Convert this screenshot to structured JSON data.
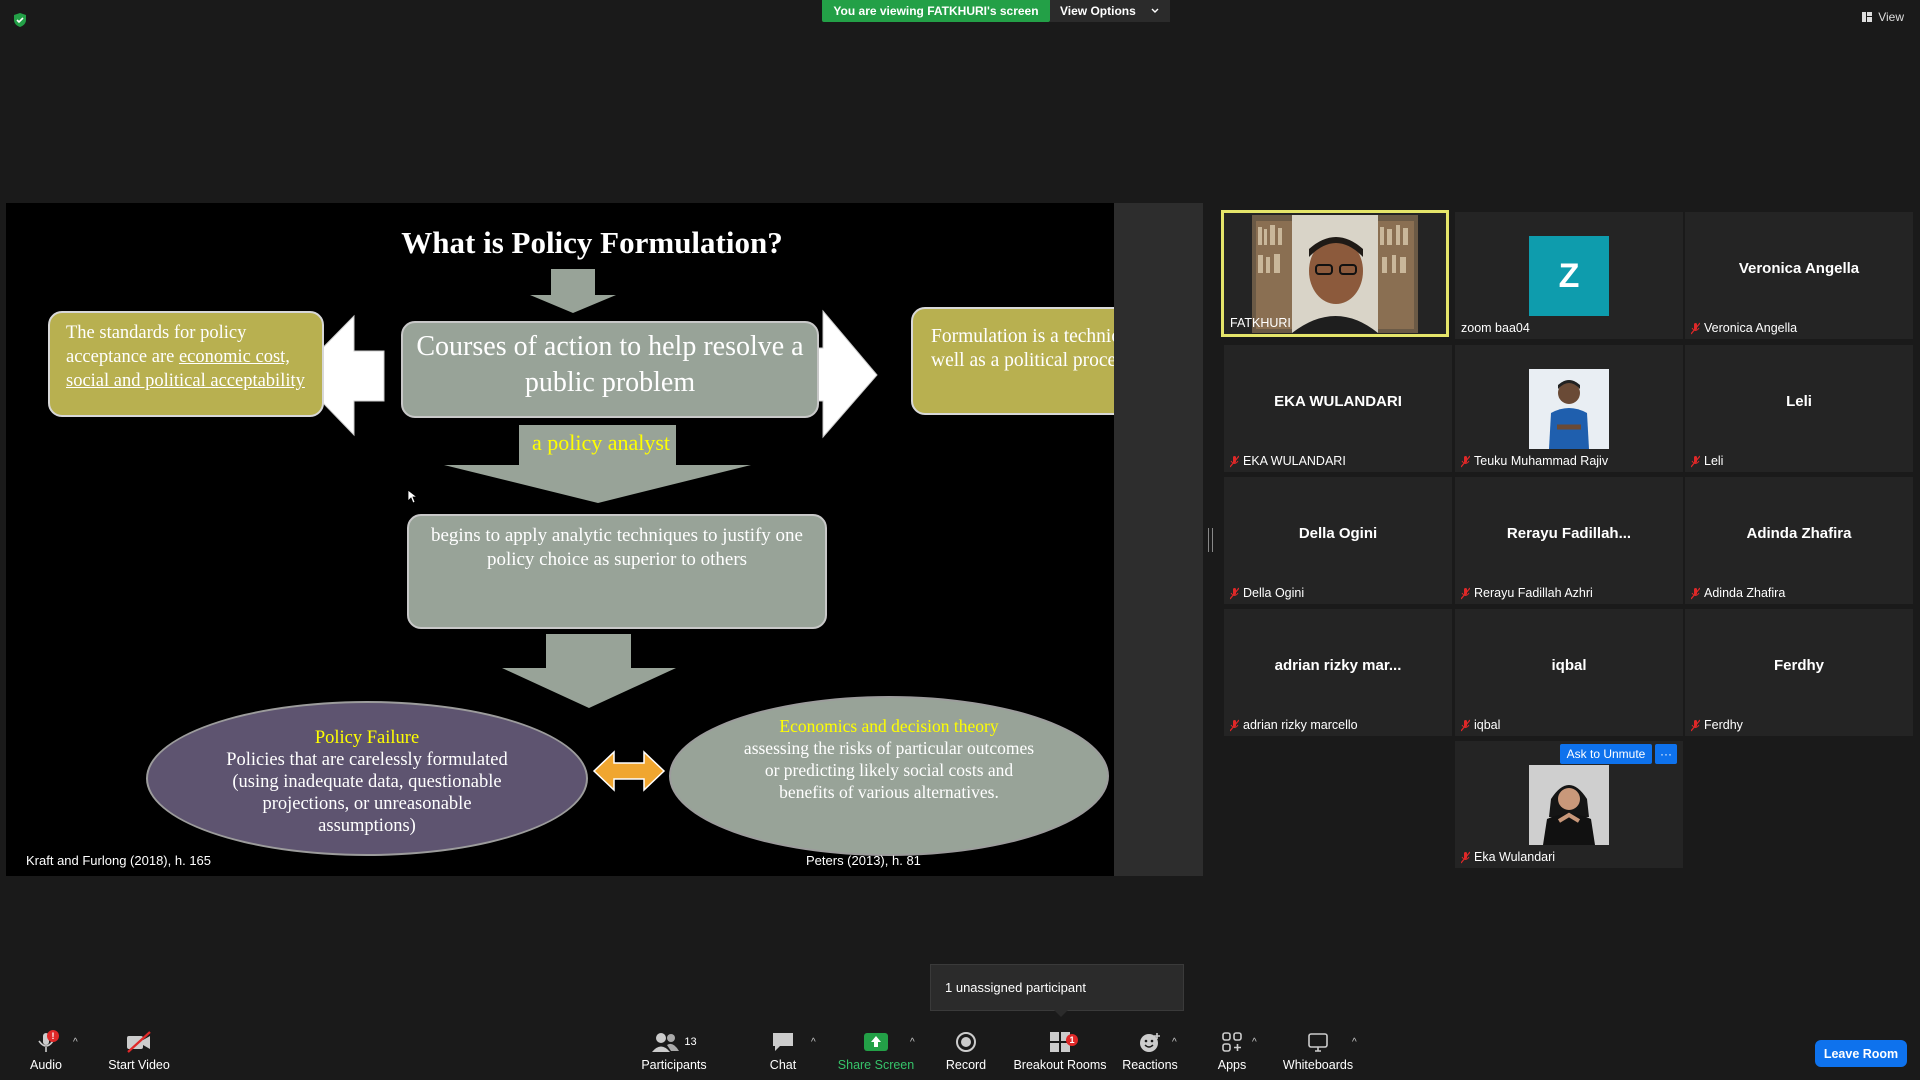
{
  "topbar": {
    "viewing_label": "You are viewing FATKHURI's screen",
    "view_options_label": "View Options",
    "view_label": "View"
  },
  "slide": {
    "title": "What is Policy Formulation?",
    "standards_text_1": "The standards for policy acceptance are ",
    "standards_text_2": "economic cost, social and political acceptability",
    "courses": "Courses of action to help resolve a public problem",
    "formulation": "Formulation is a technical as well as a political process",
    "analyst": "a policy analyst",
    "begins": "begins to apply analytic techniques to justify one policy choice as superior to others",
    "failure_heading": "Policy Failure",
    "failure_body": "Policies that are carelessly formulated (using inadequate data, questionable projections, or unreasonable assumptions)",
    "economics_heading": "Economics and decision theory",
    "economics_body": "assessing the risks of particular outcomes or predicting likely social costs and benefits of various alternatives.",
    "cite_left": "Kraft and Furlong (2018), h. 165",
    "cite_right": "Peters  (2013), h. 81"
  },
  "gallery": [
    {
      "name": "",
      "caption": "FATKHURI",
      "muted": false,
      "kind": "video"
    },
    {
      "name": "",
      "caption": "zoom baa04",
      "muted": false,
      "kind": "avatar",
      "initial": "Z"
    },
    {
      "name": "Veronica Angella",
      "caption": "Veronica Angella",
      "muted": true
    },
    {
      "name": "EKA WULANDARI",
      "caption": "EKA WULANDARI",
      "muted": true
    },
    {
      "name": "",
      "caption": "Teuku Muhammad Rajiv",
      "muted": true,
      "kind": "photo"
    },
    {
      "name": "Leli",
      "caption": "Leli",
      "muted": true
    },
    {
      "name": "Della Ogini",
      "caption": "Della Ogini",
      "muted": true
    },
    {
      "name": "Rerayu  Fadillah...",
      "caption": "Rerayu Fadillah Azhri",
      "muted": true
    },
    {
      "name": "Adinda Zhafira",
      "caption": "Adinda Zhafira",
      "muted": true
    },
    {
      "name": "adrian  rizky  mar...",
      "caption": "adrian rizky marcello",
      "muted": true
    },
    {
      "name": "iqbal",
      "caption": "iqbal",
      "muted": true
    },
    {
      "name": "Ferdhy",
      "caption": "Ferdhy",
      "muted": true
    },
    {
      "name": "",
      "caption": "Eka Wulandari",
      "muted": true,
      "kind": "photo"
    }
  ],
  "ask_unmute_label": "Ask to Unmute",
  "more_label": "···",
  "tooltip": {
    "unassigned": "1 unassigned participant"
  },
  "toolbar": {
    "audio": "Audio",
    "audio_badge": "!",
    "start_video": "Start Video",
    "participants": "Participants",
    "participants_count": "13",
    "chat": "Chat",
    "share_screen": "Share Screen",
    "record": "Record",
    "breakout_rooms": "Breakout Rooms",
    "breakout_badge": "1",
    "reactions": "Reactions",
    "apps": "Apps",
    "whiteboards": "Whiteboards",
    "leave_room": "Leave Room",
    "caret": "^"
  },
  "colors": {
    "accent_blue": "#0e72ed",
    "viewing_green": "#23a047",
    "active_speaker": "#e5e56a",
    "mute_red": "#e02828"
  }
}
